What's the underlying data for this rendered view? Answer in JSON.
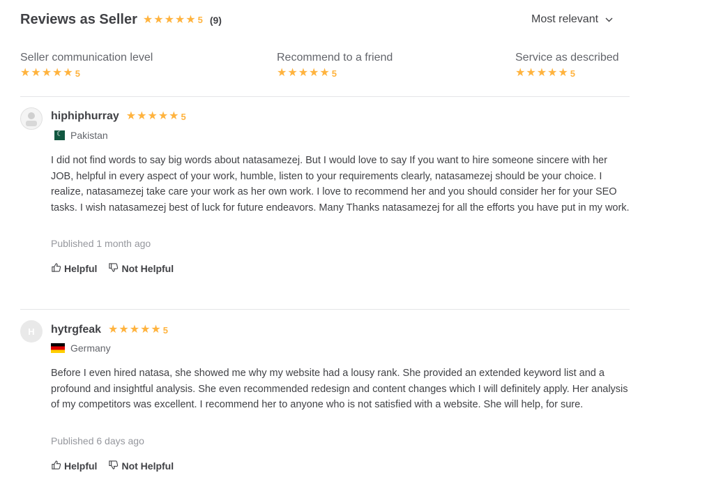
{
  "header": {
    "title": "Reviews as Seller",
    "stars": "★★★★★",
    "rating": "5",
    "count": "(9)",
    "sort_label": "Most relevant",
    "sort_icon": "chevron-down-icon"
  },
  "breakdown": [
    {
      "label": "Seller communication level",
      "stars": "★★★★★",
      "rating": "5"
    },
    {
      "label": "Recommend to a friend",
      "stars": "★★★★★",
      "rating": "5"
    },
    {
      "label": "Service as described",
      "stars": "★★★★★",
      "rating": "5"
    }
  ],
  "reviews": [
    {
      "username": "hiphiphurray",
      "stars": "★★★★★",
      "rating": "5",
      "country": "Pakistan",
      "avatar_letter": "",
      "text": "I did not find words to say big words about natasamezej. But I would love to say If you want to hire someone sincere with her JOB, helpful in every aspect of your work, humble, listen to your requirements clearly, natasamezej should be your choice. I realize, natasamezej take care your work as her own work. I love to recommend her and you should consider her for your SEO tasks. I wish natasamezej best of luck for future endeavors. Many Thanks natasamezej for all the efforts you have put in my work.",
      "published": "Published 1 month ago",
      "helpful": "Helpful",
      "not_helpful": "Not Helpful"
    },
    {
      "username": "hytrgfeak",
      "stars": "★★★★★",
      "rating": "5",
      "country": "Germany",
      "avatar_letter": "H",
      "text": "Before I even hired natasa, she showed me why my website had a lousy rank. She provided an extended keyword list and a profound and insightful analysis. She even recommended redesign and content changes which I will definitely apply. Her analysis of my competitors was excellent. I recommend her to anyone who is not satisfied with a website. She will help, for sure.",
      "published": "Published 6 days ago",
      "helpful": "Helpful",
      "not_helpful": "Not Helpful"
    }
  ],
  "colors": {
    "star": "#ffb33e",
    "text": "#404145",
    "muted": "#95979d",
    "divider": "#e4e5e7"
  }
}
